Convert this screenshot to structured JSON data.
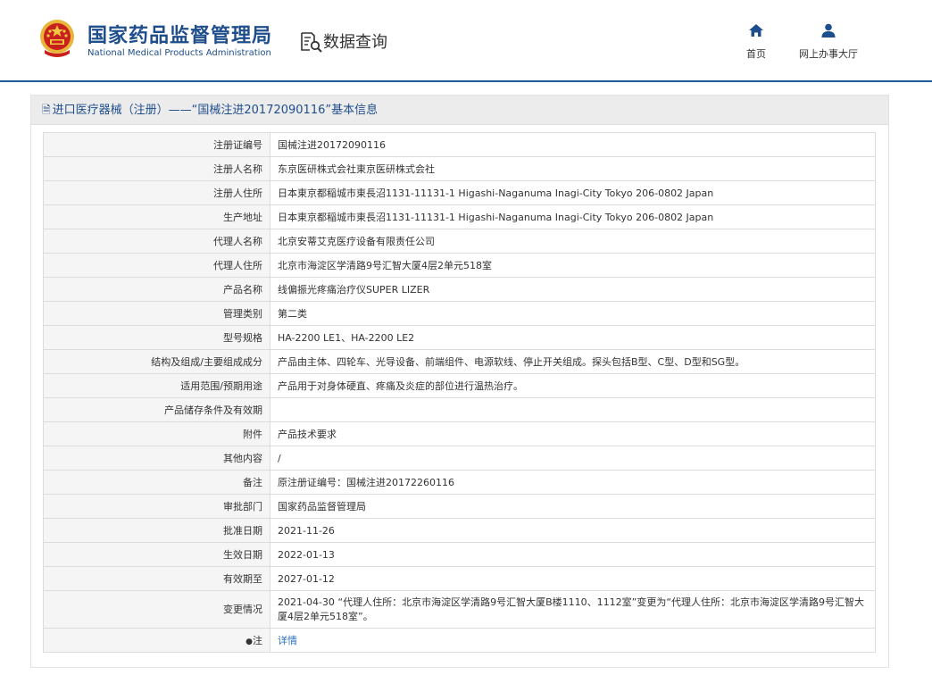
{
  "header": {
    "brand_cn": "国家药品监督管理局",
    "brand_en": "National Medical Products Administration",
    "query_label": "数据查询",
    "nav": {
      "home_label": "首页",
      "hall_label": "网上办事大厅"
    },
    "colors": {
      "brand": "#1f4e8c",
      "accent_line": "#1f5c99"
    }
  },
  "panel": {
    "title": "进口医疗器械（注册）——“国械注进20172090116”基本信息",
    "rows": [
      {
        "label": "注册证编号",
        "value": "国械注进20172090116"
      },
      {
        "label": "注册人名称",
        "value": "东京医研株式会社東京医研株式会社"
      },
      {
        "label": "注册人住所",
        "value": "日本東京都稲城市東長沼1131-11131-1 Higashi-Naganuma Inagi-City Tokyo 206-0802 Japan"
      },
      {
        "label": "生产地址",
        "value": "日本東京都稲城市東長沼1131-11131-1 Higashi-Naganuma Inagi-City Tokyo 206-0802 Japan"
      },
      {
        "label": "代理人名称",
        "value": "北京安蒂艾克医疗设备有限责任公司"
      },
      {
        "label": "代理人住所",
        "value": "北京市海淀区学清路9号汇智大厦4层2单元518室"
      },
      {
        "label": "产品名称",
        "value": "线偏振光疼痛治疗仪SUPER LIZER"
      },
      {
        "label": "管理类别",
        "value": "第二类"
      },
      {
        "label": "型号规格",
        "value": "HA-2200 LE1、HA-2200 LE2"
      },
      {
        "label": "结构及组成/主要组成成分",
        "value": "产品由主体、四轮车、光导设备、前端组件、电源软线、停止开关组成。探头包括B型、C型、D型和SG型。"
      },
      {
        "label": "适用范围/预期用途",
        "value": "产品用于对身体硬直、疼痛及炎症的部位进行温热治疗。"
      },
      {
        "label": "产品储存条件及有效期",
        "value": ""
      },
      {
        "label": "附件",
        "value": "产品技术要求"
      },
      {
        "label": "其他内容",
        "value": "/"
      },
      {
        "label": "备注",
        "value": "原注册证编号：国械注进20172260116"
      },
      {
        "label": "审批部门",
        "value": "国家药品监督管理局"
      },
      {
        "label": "批准日期",
        "value": "2021-11-26"
      },
      {
        "label": "生效日期",
        "value": "2022-01-13"
      },
      {
        "label": "有效期至",
        "value": "2027-01-12"
      },
      {
        "label": "变更情况",
        "value": "2021-04-30 “代理人住所：北京市海淀区学清路9号汇智大厦B楼1110、1112室”变更为“代理人住所：北京市海淀区学清路9号汇智大厦4层2单元518室”。"
      }
    ],
    "note": {
      "label": "注",
      "value": "详情"
    }
  }
}
